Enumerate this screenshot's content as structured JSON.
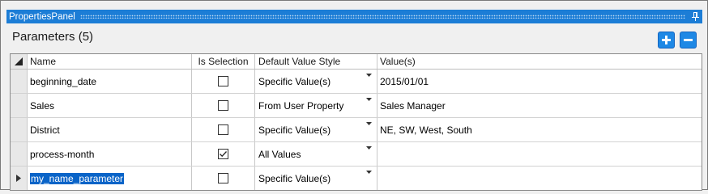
{
  "panel": {
    "title": "PropertiesPanel",
    "header": "Parameters (5)",
    "add_icon": "plus-icon",
    "remove_icon": "minus-icon",
    "accent_color": "#1c7dd6"
  },
  "grid": {
    "columns": [
      "Name",
      "Is Selection",
      "Default Value Style",
      "Value(s)"
    ],
    "rows": [
      {
        "name": "beginning_date",
        "is_selection": false,
        "style": "Specific Value(s)",
        "values": "2015/01/01"
      },
      {
        "name": "Sales",
        "is_selection": false,
        "style": "From User Property",
        "values": "Sales Manager"
      },
      {
        "name": "District",
        "is_selection": false,
        "style": "Specific Value(s)",
        "values": "NE, SW, West, South"
      },
      {
        "name": "process-month",
        "is_selection": true,
        "style": "All Values",
        "values": ""
      },
      {
        "name": "my_name_parameter",
        "is_selection": false,
        "style": "Specific Value(s)",
        "values": ""
      }
    ]
  }
}
